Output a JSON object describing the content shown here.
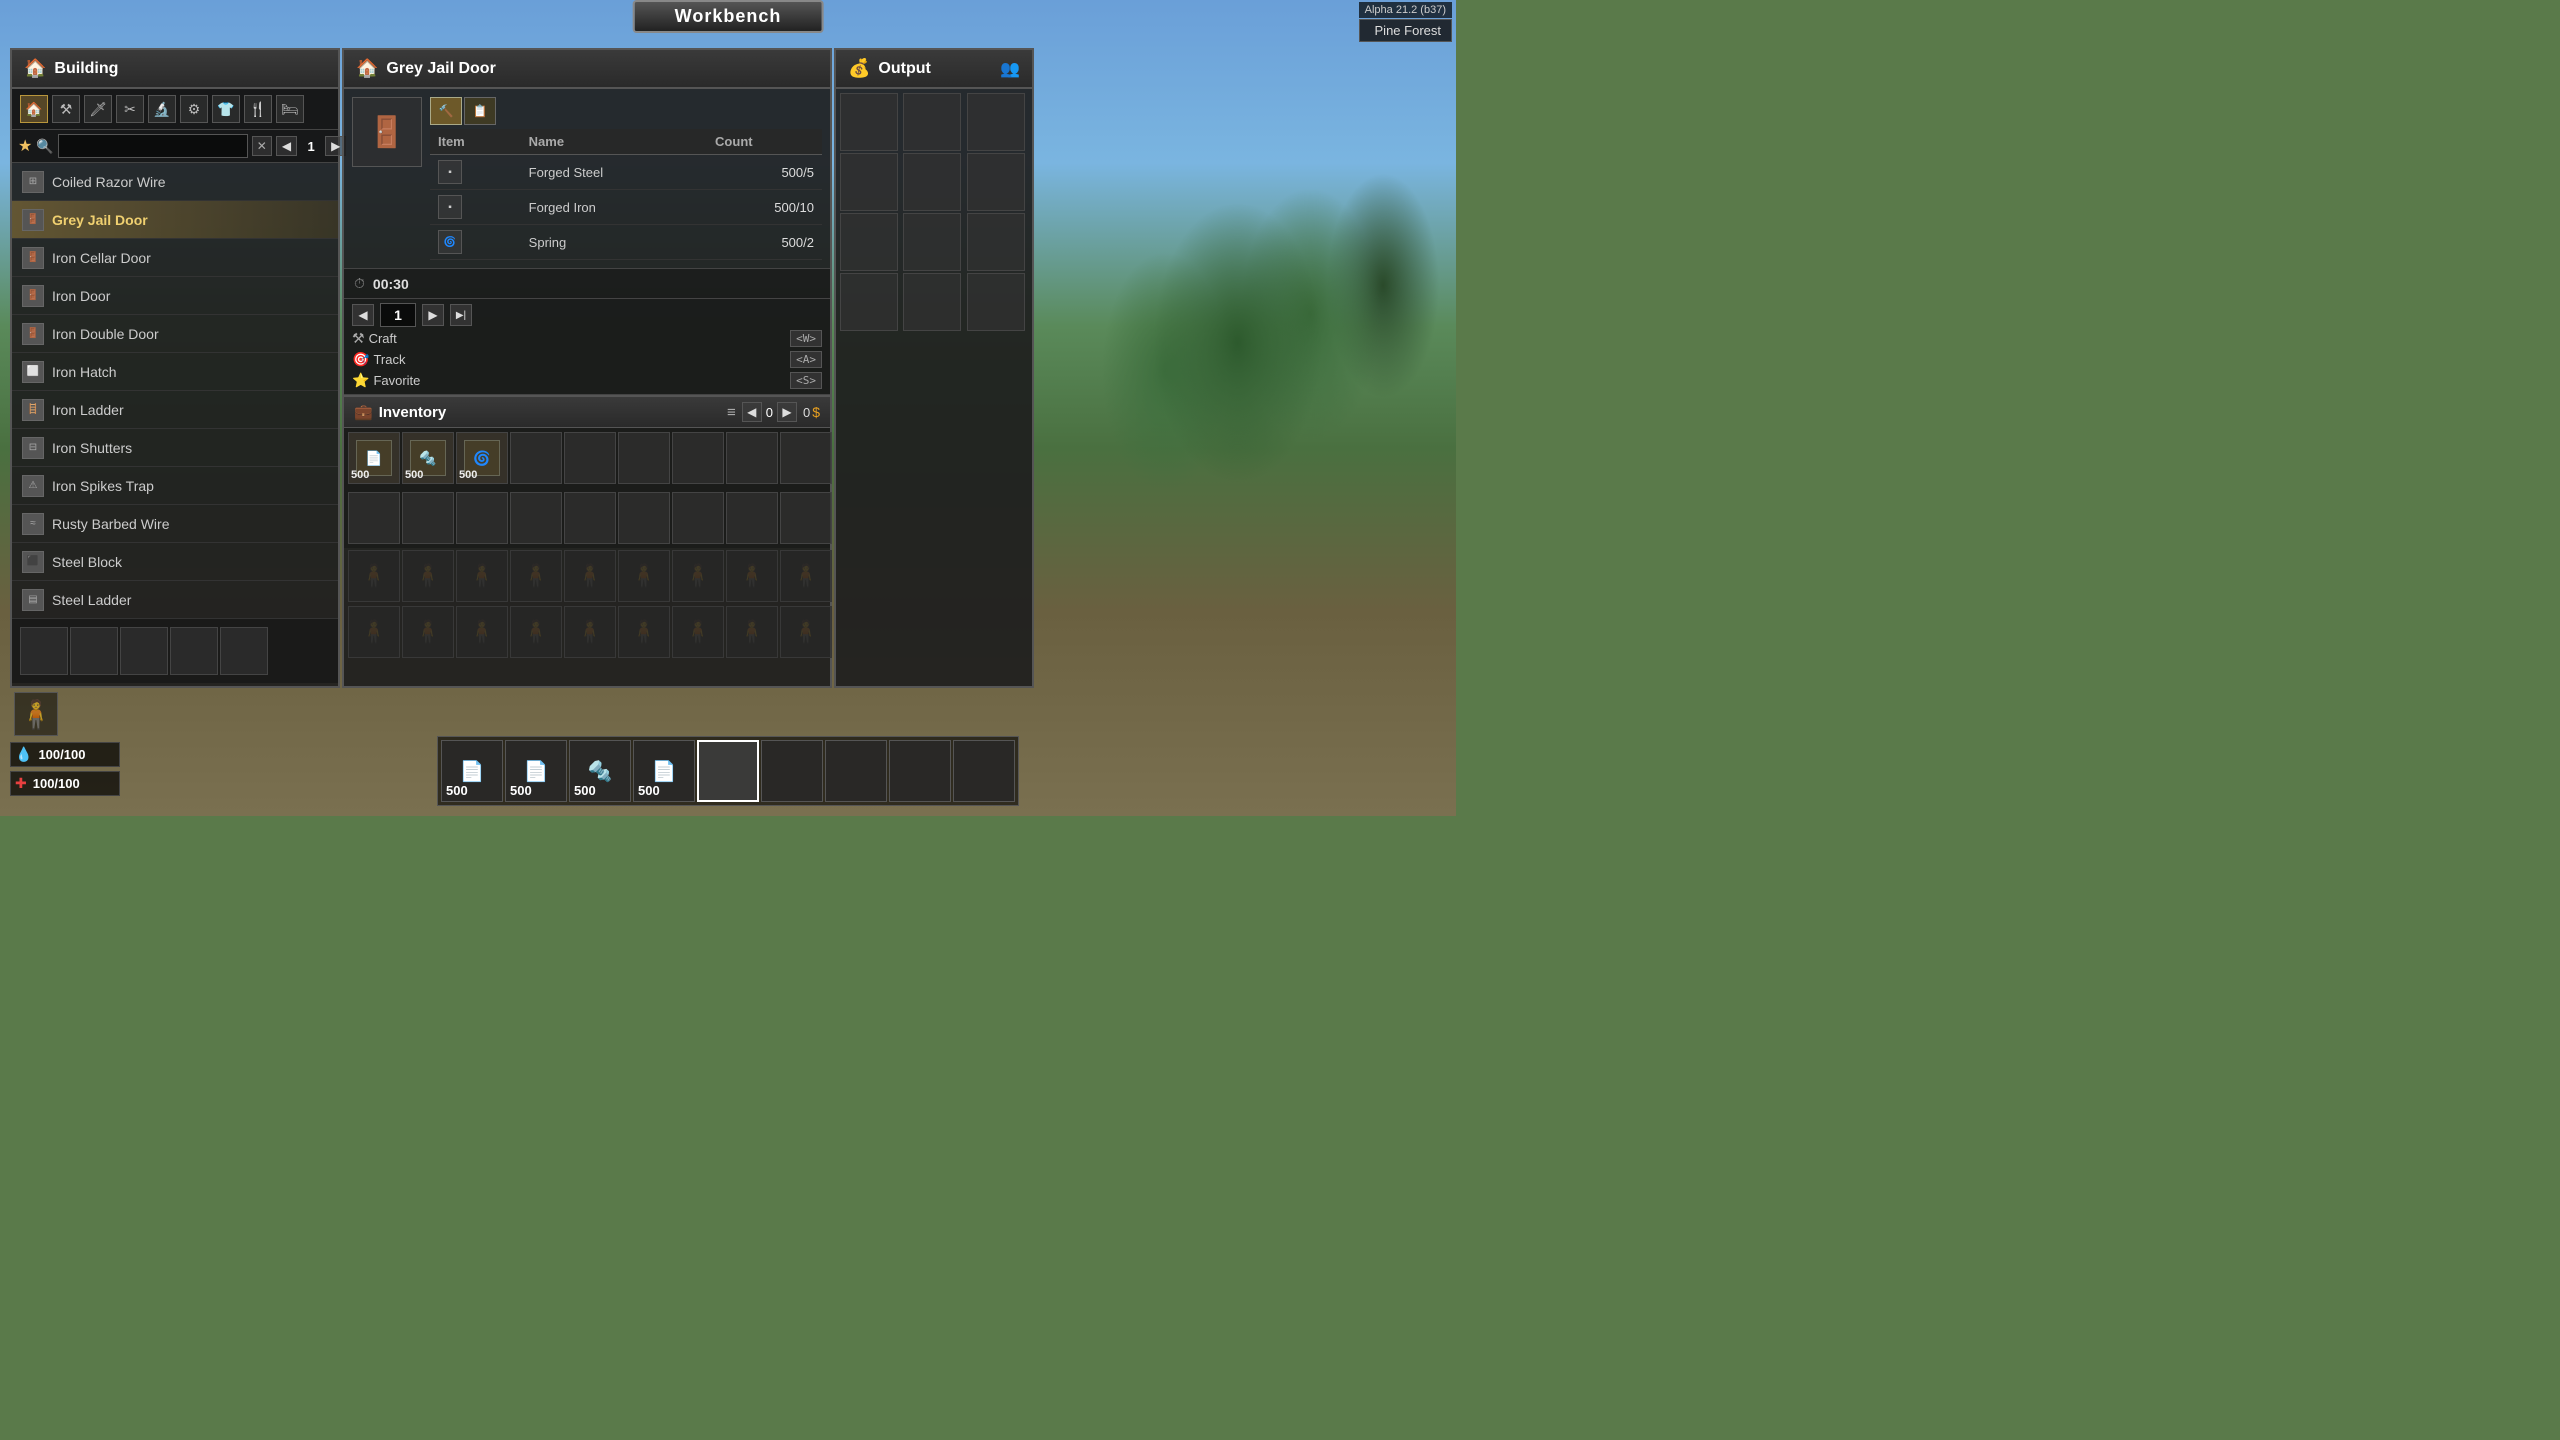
{
  "title": "Workbench",
  "version": "Alpha 21.2 (b37)",
  "location": "Pine Forest",
  "building_panel": {
    "title": "Building",
    "icon": "🏠",
    "toolbar_icons": [
      "🏠",
      "⚒",
      "🔪",
      "✂",
      "🔬",
      "⚙",
      "👕",
      "🍴",
      "🛏"
    ],
    "search_placeholder": "",
    "page": 1,
    "items": [
      {
        "name": "Coiled Razor Wire",
        "selected": false,
        "icon": "🔩"
      },
      {
        "name": "Grey Jail Door",
        "selected": true,
        "icon": "🚪"
      },
      {
        "name": "Iron Cellar Door",
        "selected": false,
        "icon": "🚪"
      },
      {
        "name": "Iron Door",
        "selected": false,
        "icon": "🚪"
      },
      {
        "name": "Iron Double Door",
        "selected": false,
        "icon": "🚪"
      },
      {
        "name": "Iron Hatch",
        "selected": false,
        "icon": "🔲"
      },
      {
        "name": "Iron Ladder",
        "selected": false,
        "icon": "🪜"
      },
      {
        "name": "Iron Shutters",
        "selected": false,
        "icon": "🔲"
      },
      {
        "name": "Iron Spikes Trap",
        "selected": false,
        "icon": "⚠"
      },
      {
        "name": "Rusty Barbed Wire",
        "selected": false,
        "icon": "🔩"
      },
      {
        "name": "Steel Block",
        "selected": false,
        "icon": "⬜"
      },
      {
        "name": "Steel Ladder",
        "selected": false,
        "icon": "🪜"
      }
    ]
  },
  "craft_panel": {
    "title": "Grey Jail Door",
    "icon": "🏠",
    "timer": "00:30",
    "quantity": 1,
    "recipe": {
      "columns": [
        "Item",
        "Name",
        "Count"
      ],
      "rows": [
        {
          "icon": "📄",
          "name": "Forged Steel",
          "count": "500/5",
          "sufficient": true
        },
        {
          "icon": "📄",
          "name": "Forged Iron",
          "count": "500/10",
          "sufficient": true
        },
        {
          "icon": "🔩",
          "name": "Spring",
          "count": "500/2",
          "sufficient": true
        }
      ]
    },
    "actions": [
      {
        "icon": "⚒",
        "label": "Craft",
        "key": "<W>"
      },
      {
        "icon": "🎯",
        "label": "Track",
        "key": "<A>"
      },
      {
        "icon": "⭐",
        "label": "Favorite",
        "key": "<S>"
      }
    ]
  },
  "inventory_panel": {
    "title": "Inventory",
    "icon": "💼",
    "page": 0,
    "coins": 0,
    "slots": [
      {
        "has_item": true,
        "icon": "📄",
        "count": "500"
      },
      {
        "has_item": true,
        "icon": "🔩",
        "count": "500"
      },
      {
        "has_item": true,
        "icon": "🌀",
        "count": "500"
      },
      {
        "has_item": false,
        "icon": "",
        "count": ""
      },
      {
        "has_item": false,
        "icon": "",
        "count": ""
      },
      {
        "has_item": false,
        "icon": "",
        "count": ""
      },
      {
        "has_item": false,
        "icon": "",
        "count": ""
      },
      {
        "has_item": false,
        "icon": "",
        "count": ""
      },
      {
        "has_item": false,
        "icon": "",
        "count": ""
      },
      {
        "has_item": false,
        "icon": "",
        "count": ""
      },
      {
        "has_item": false,
        "icon": "",
        "count": ""
      },
      {
        "has_item": false,
        "icon": "",
        "count": ""
      },
      {
        "has_item": false,
        "icon": "",
        "count": ""
      },
      {
        "has_item": false,
        "icon": "",
        "count": ""
      },
      {
        "has_item": false,
        "icon": "",
        "count": ""
      },
      {
        "has_item": false,
        "icon": "",
        "count": ""
      },
      {
        "has_item": false,
        "icon": "",
        "count": ""
      },
      {
        "has_item": false,
        "icon": "",
        "count": ""
      }
    ],
    "char_slots": 18
  },
  "output_panel": {
    "title": "Output",
    "icon": "💰",
    "slots": 12
  },
  "hotbar": {
    "slots": [
      {
        "count": "500",
        "active": false,
        "icon": "📄"
      },
      {
        "count": "500",
        "active": false,
        "icon": "📄"
      },
      {
        "count": "500",
        "active": false,
        "icon": "🔩"
      },
      {
        "count": "500",
        "active": false,
        "icon": "📄"
      },
      {
        "count": "",
        "active": true,
        "icon": ""
      },
      {
        "count": "",
        "active": false,
        "icon": ""
      },
      {
        "count": "",
        "active": false,
        "icon": ""
      },
      {
        "count": "",
        "active": false,
        "icon": ""
      },
      {
        "count": "",
        "active": false,
        "icon": ""
      }
    ]
  },
  "health": {
    "stamina": {
      "value": 100,
      "max": 100,
      "label": "100/100"
    },
    "hp": {
      "value": 100,
      "max": 100,
      "label": "100/100"
    }
  },
  "labels": {
    "craft": "Craft",
    "track": "Track",
    "favorite": "Favorite",
    "craft_key": "<W>",
    "track_key": "<A>",
    "fav_key": "<S>",
    "building": "Building",
    "inventory": "Inventory",
    "output": "Output",
    "item_col": "Item",
    "name_col": "Name",
    "count_col": "Count"
  }
}
